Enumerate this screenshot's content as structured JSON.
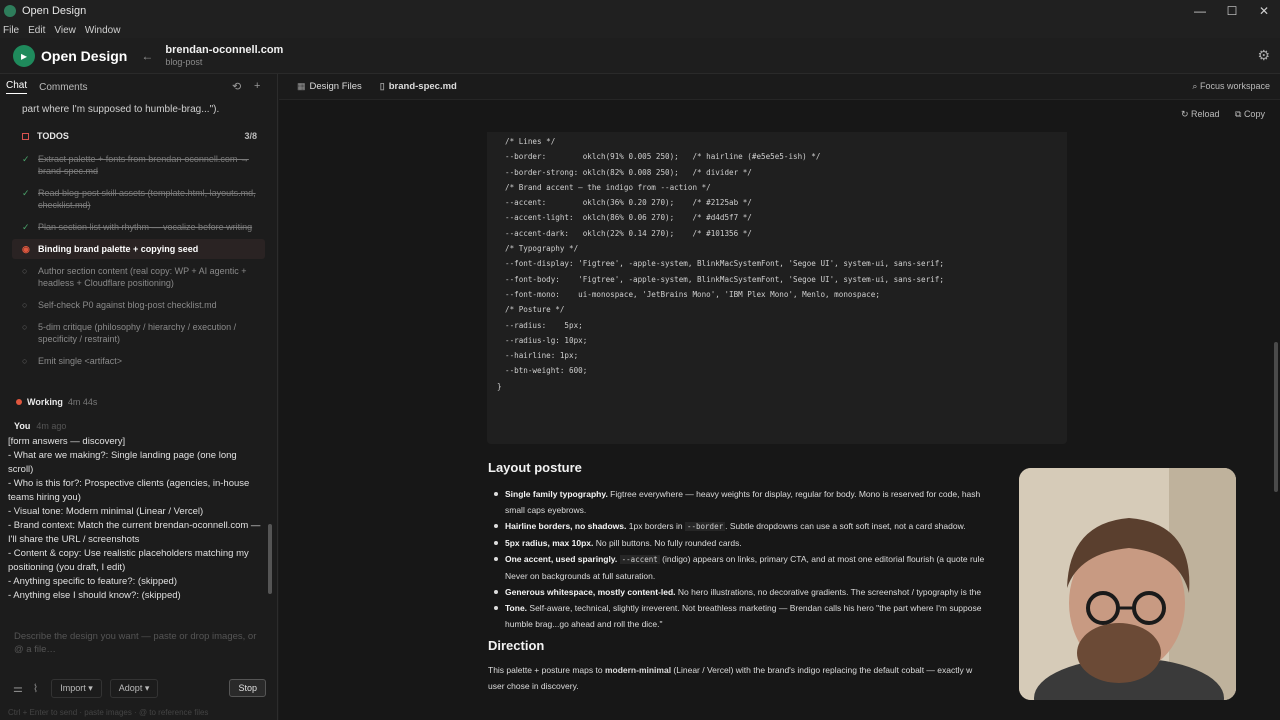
{
  "window": {
    "title": "Open Design",
    "controls": [
      "—",
      "☐",
      "✕"
    ]
  },
  "menu": [
    "File",
    "Edit",
    "View",
    "Window"
  ],
  "header": {
    "brand": "Open Design",
    "project_name": "brendan-oconnell.com",
    "project_type": "blog-post"
  },
  "left": {
    "tabs": [
      "Chat",
      "Comments"
    ],
    "quote_tail": "part where I'm supposed to humble-brag...\").",
    "todos": {
      "title": "TODOS",
      "count": "3/8",
      "items": [
        {
          "text": "Extract palette + fonts from brendan-oconnell.com → brand-spec.md",
          "state": "done"
        },
        {
          "text": "Read blog-post skill assets (template.html, layouts.md, checklist.md)",
          "state": "done"
        },
        {
          "text": "Plan section list with rhythm — vocalize before writing",
          "state": "done"
        },
        {
          "text": "Binding brand palette + copying seed",
          "state": "active"
        },
        {
          "text": "Author section content (real copy: WP + AI agentic + headless + Cloudflare positioning)",
          "state": "pending"
        },
        {
          "text": "Self-check P0 against blog-post checklist.md",
          "state": "pending"
        },
        {
          "text": "5-dim critique (philosophy / hierarchy / execution / specificity / restraint)",
          "state": "pending"
        },
        {
          "text": "Emit single <artifact>",
          "state": "pending"
        }
      ]
    },
    "working": {
      "label": "Working",
      "time": "4m 44s"
    },
    "you": {
      "label": "You",
      "time": "4m ago"
    },
    "message_lines": [
      "[form answers — discovery]",
      "- What are we making?: Single landing page (one long scroll)",
      "- Who is this for?: Prospective clients (agencies, in-house teams hiring you)",
      "- Visual tone: Modern minimal (Linear / Vercel)",
      "- Brand context: Match the current brendan-oconnell.com — I'll share the URL / screenshots",
      "- Content & copy: Use realistic placeholders matching my positioning (you draft, I edit)",
      "- Anything specific to feature?: (skipped)",
      "- Anything else I should know?: (skipped)"
    ],
    "composer_placeholder": "Describe the design you want — paste or drop images, or @ a file…",
    "import_label": "Import",
    "adopt_label": "Adopt",
    "stop_label": "Stop",
    "hint": "Ctrl + Enter to send · paste images · @ to reference files"
  },
  "right": {
    "tabs": [
      {
        "label": "Design Files",
        "icon": "grid"
      },
      {
        "label": "brand-spec.md",
        "icon": "file"
      }
    ],
    "focus_label": "Focus workspace",
    "reload_label": "Reload",
    "copy_label": "Copy",
    "code_lines": [
      "/* Lines */",
      "--border:        oklch(91% 0.005 250);   /* hairline (#e5e5e5-ish) */",
      "--border-strong: oklch(82% 0.008 250);   /* divider */",
      "",
      "/* Brand accent — the indigo from --action */",
      "--accent:        oklch(36% 0.20 270);    /* #2125ab */",
      "--accent-light:  oklch(86% 0.06 270);    /* #d4d5f7 */",
      "--accent-dark:   oklch(22% 0.14 270);    /* #101356 */",
      "",
      "/* Typography */",
      "--font-display: 'Figtree', -apple-system, BlinkMacSystemFont, 'Segoe UI', system-ui, sans-serif;",
      "--font-body:    'Figtree', -apple-system, BlinkMacSystemFont, 'Segoe UI', system-ui, sans-serif;",
      "--font-mono:    ui-monospace, 'JetBrains Mono', 'IBM Plex Mono', Menlo, monospace;",
      "",
      "/* Posture */",
      "--radius:    5px;",
      "--radius-lg: 10px;",
      "--hairline: 1px;",
      "--btn-weight: 600;"
    ],
    "code_close": "}",
    "layout_heading": "Layout posture",
    "posture_items": [
      {
        "bold": "Single family typography.",
        "text": " Figtree everywhere — heavy weights for display, regular for body. Mono is reserved for code, hash",
        "text2": "small caps eyebrows."
      },
      {
        "bold": "Hairline borders, no shadows.",
        "text": " 1px borders in ",
        "code": "--border",
        "text_after": ". Subtle dropdowns can use a soft soft inset, not a card shadow."
      },
      {
        "bold": "5px radius, max 10px.",
        "text": " No pill buttons. No fully rounded cards."
      },
      {
        "bold": "One accent, used sparingly.",
        "text": " ",
        "code": "--accent",
        "text_after": " (indigo) appears on links, primary CTA, and at most one editorial flourish (a quote rule",
        "text2": "Never on backgrounds at full saturation."
      },
      {
        "bold": "Generous whitespace, mostly content-led.",
        "text": " No hero illustrations, no decorative gradients. The screenshot / typography is the"
      },
      {
        "bold": "Tone.",
        "text": " Self-aware, technical, slightly irreverent. Not breathless marketing — Brendan calls his hero \"the part where I'm suppose",
        "text2": "humble brag...go ahead and roll the dice.\""
      }
    ],
    "direction_heading": "Direction",
    "direction_pre": "This palette + posture maps to ",
    "direction_bold": "modern-minimal",
    "direction_post": " (Linear / Vercel) with the brand's indigo replacing the default cobalt — exactly w",
    "direction_line2": "user chose in discovery."
  },
  "colors": {
    "accent_green": "#1f8a5c",
    "active_red": "#e0573e",
    "done_green": "#4aa36a"
  }
}
